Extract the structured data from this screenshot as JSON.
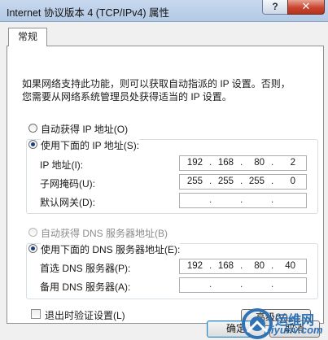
{
  "window": {
    "title": "Internet 协议版本 4 (TCP/IPv4) 属性",
    "help_glyph": "?",
    "close_glyph": "✕"
  },
  "tab": {
    "label": "常规"
  },
  "description": {
    "line1": "如果网络支持此功能，则可以获取自动指派的 IP 设置。否则，",
    "line2": "您需要从网络系统管理员处获得适当的 IP 设置。"
  },
  "ip": {
    "auto_label": "自动获得 IP 地址(O)",
    "auto_selected": false,
    "manual_label": "使用下面的 IP 地址(S):",
    "manual_selected": true,
    "address_label": "IP 地址(I):",
    "address": [
      "192",
      "168",
      "80",
      "2"
    ],
    "mask_label": "子网掩码(U):",
    "mask": [
      "255",
      "255",
      "255",
      "0"
    ],
    "gateway_label": "默认网关(D):",
    "gateway": [
      "",
      "",
      "",
      ""
    ]
  },
  "dns": {
    "auto_label": "自动获得 DNS 服务器地址(B)",
    "auto_selected": false,
    "auto_enabled": false,
    "manual_label": "使用下面的 DNS 服务器地址(E):",
    "manual_selected": true,
    "preferred_label": "首选 DNS 服务器(P):",
    "preferred": [
      "192",
      "168",
      "80",
      "40"
    ],
    "alternate_label": "备用 DNS 服务器(A):",
    "alternate": [
      "",
      "",
      "",
      ""
    ]
  },
  "validate": {
    "label": "退出时验证设置(L)",
    "checked": false
  },
  "buttons": {
    "advanced": "高级(V)...",
    "ok": "确定",
    "cancel": "取消"
  },
  "watermark": {
    "brand": "运维网",
    "url": "iyunv.com"
  }
}
